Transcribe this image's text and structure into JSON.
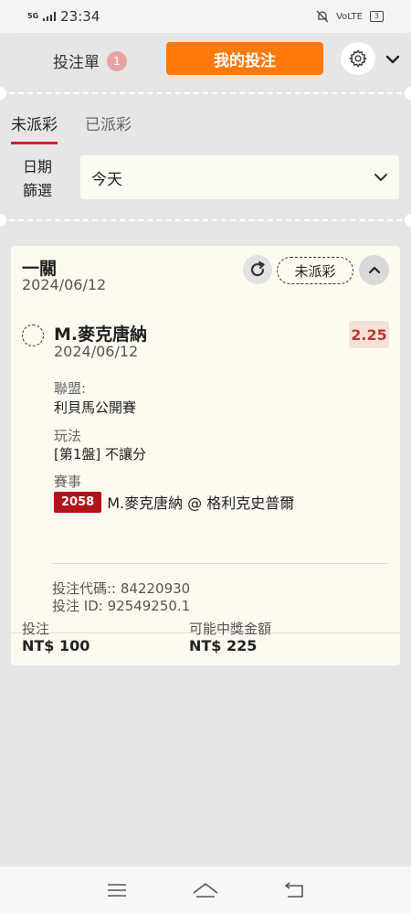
{
  "status_bar": {
    "network": "5G",
    "time": "23:34",
    "volte": "VoLTE",
    "battery": "3"
  },
  "header": {
    "betslip_label": "投注單",
    "betslip_count": "1",
    "my_bets_label": "我的投注",
    "icons": {
      "settings": "gear-icon",
      "collapse": "chevron-down-icon"
    }
  },
  "tabs": [
    {
      "label": "未派彩",
      "active": true
    },
    {
      "label": "已派彩",
      "active": false
    }
  ],
  "date_filter": {
    "label": "日期篩選",
    "value": "今天"
  },
  "bet_card": {
    "type": "一關",
    "date": "2024/06/12",
    "status": "未派彩",
    "selection": {
      "name": "M.麥克唐納",
      "date": "2024/06/12",
      "odds": "2.25",
      "league_label": "聯盟:",
      "league": "利貝馬公開賽",
      "market_label": "玩法",
      "market": "[第1盤] 不讓分",
      "event_label": "賽事",
      "event_id": "2058",
      "event_name": "M.麥克唐納 @ 格利克史普爾"
    },
    "bet_code": "投注代碼:: 84220930",
    "bet_id": "投注 ID: 92549250.1",
    "stake_label": "投注",
    "stake": "NT$ 100",
    "payout_label": "可能中獎金額",
    "payout": "NT$ 225"
  },
  "colors": {
    "accent": "#ff7a0a",
    "status_red": "#d0202a",
    "odds_red": "#c0392b",
    "card_bg": "#fdfbf0"
  }
}
